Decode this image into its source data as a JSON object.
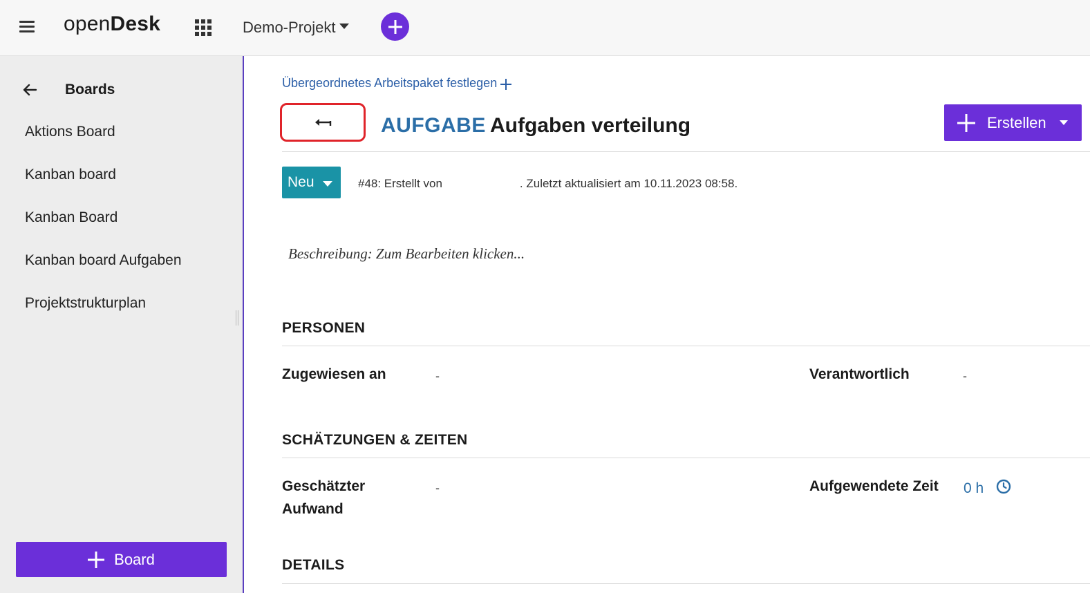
{
  "header": {
    "logo_light": "open",
    "logo_bold": "Desk",
    "project": "Demo-Projekt"
  },
  "sidebar": {
    "title": "Boards",
    "items": [
      {
        "label": "Aktions Board"
      },
      {
        "label": "Kanban board"
      },
      {
        "label": "Kanban Board"
      },
      {
        "label": "Kanban board Aufgaben"
      },
      {
        "label": "Projektstrukturplan"
      }
    ],
    "board_button": "Board"
  },
  "workpackage": {
    "parent_link": "Übergeordnetes Arbeitspaket festlegen",
    "type": "AUFGABE",
    "subject": "Aufgaben verteilung",
    "create_button": "Erstellen",
    "status": "Neu",
    "meta_prefix": "#48: Erstellt von",
    "meta_suffix": ". Zuletzt aktualisiert am 10.11.2023 08:58.",
    "description_placeholder": "Beschreibung: Zum Bearbeiten klicken..."
  },
  "sections": {
    "persons": {
      "title": "PERSONEN",
      "assignee_label": "Zugewiesen an",
      "assignee_value": "-",
      "responsible_label": "Verantwortlich",
      "responsible_value": "-"
    },
    "estimates": {
      "title": "SCHÄTZUNGEN & ZEITEN",
      "estimated_label_line1": "Geschätzter",
      "estimated_label_line2": "Aufwand",
      "estimated_value": "-",
      "spent_label": "Aufgewendete Zeit",
      "spent_value": "0 h"
    },
    "details": {
      "title": "DETAILS"
    }
  },
  "colors": {
    "accent": "#6b2fd9",
    "status": "#1a93a6",
    "link": "#2b5ea7",
    "highlight_border": "#e0242a"
  },
  "icons": [
    "menu-icon",
    "apps-grid-icon",
    "caret-down-icon",
    "plus-icon",
    "arrow-left-icon",
    "back-arrow-icon",
    "clock-icon"
  ]
}
